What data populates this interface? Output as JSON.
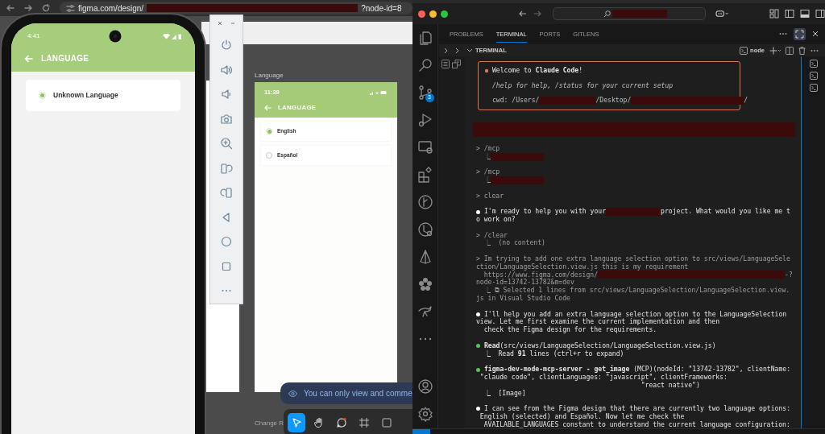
{
  "browser": {
    "url": [
      {
        "kind": "text",
        "text": "figma.com/design/"
      },
      {
        "kind": "redaction"
      },
      {
        "kind": "text",
        "text": "?node-id=8"
      }
    ]
  },
  "figma": {
    "frame_label": "Language",
    "frame": {
      "time": "11:39",
      "title": "LANGUAGE",
      "options": [
        {
          "label": "English",
          "selected": true
        },
        {
          "label": "Español",
          "selected": false
        }
      ]
    },
    "toast": "You can only view and comme",
    "canvas_label": "Change R",
    "tools": [
      {
        "kind": "move",
        "selected": true
      },
      {
        "kind": "hand",
        "selected": false
      },
      {
        "kind": "comment",
        "selected": false
      },
      {
        "kind": "frame",
        "selected": false
      },
      {
        "kind": "shape",
        "selected": false
      }
    ]
  },
  "phone": {
    "time": "4:41",
    "title": "LANGUAGE",
    "options": [
      {
        "label": "Unknown Language",
        "selected": true
      }
    ]
  },
  "vscode": {
    "scm_badge": "3",
    "tabs": [
      {
        "label": "PROBLEMS",
        "selected": false
      },
      {
        "label": "TERMINAL",
        "selected": true
      },
      {
        "label": "PORTS",
        "selected": false
      },
      {
        "label": "GITLENS",
        "selected": false
      }
    ],
    "terminal_title": "TERMINAL",
    "shell": "node",
    "welcome": {
      "title": "Welcome to **Claude Code**!",
      "hint": "/help for help, /status for your current setup",
      "cwd": [
        {
          "kind": "text",
          "text": "cwd: /Users/"
        },
        {
          "kind": "redaction"
        },
        {
          "kind": "text",
          "text": "/Desktop/"
        },
        {
          "kind": "redaction"
        },
        {
          "kind": "text",
          "text": "/"
        }
      ]
    },
    "entries": [
      {
        "kind": "redaction"
      },
      {
        "kind": "prompt",
        "lines": [
          [
            {
              "kind": "text",
              "text": "> /mcp"
            }
          ],
          [
            {
              "kind": "text",
              "text": "  ⎿"
            },
            {
              "kind": "redaction"
            }
          ]
        ]
      },
      {
        "kind": "prompt",
        "lines": [
          [
            {
              "kind": "text",
              "text": "> /mcp"
            }
          ],
          [
            {
              "kind": "text",
              "text": "  ⎿"
            },
            {
              "kind": "redaction"
            }
          ]
        ]
      },
      {
        "kind": "prompt",
        "lines": [
          [
            {
              "kind": "text",
              "text": "> clear"
            }
          ]
        ]
      },
      {
        "kind": "message",
        "color": "#ffffff",
        "lines": [
          [
            {
              "kind": "text",
              "text": "I'm ready to help you with your"
            },
            {
              "kind": "redaction"
            },
            {
              "kind": "text",
              "text": "project. What would you like me t"
            }
          ],
          [
            {
              "kind": "text",
              "text": "o work on?"
            }
          ]
        ]
      },
      {
        "kind": "prompt",
        "lines": [
          [
            {
              "kind": "text",
              "text": "> /clear"
            }
          ],
          [
            {
              "kind": "text",
              "text": "  ⎿  (no content)"
            }
          ]
        ]
      },
      {
        "kind": "prompt",
        "lines": [
          [
            {
              "kind": "text",
              "text": "> Im trying to add one extra language selection option to src/views/LanguageSele"
            }
          ],
          [
            {
              "kind": "text",
              "text": "ction/LanguageSelection.view.js this is my requirement"
            }
          ],
          [
            {
              "kind": "text",
              "text": "  https://www.figma.com/design/"
            },
            {
              "kind": "redaction"
            },
            {
              "kind": "text",
              "text": "-?"
            }
          ],
          [
            {
              "kind": "text",
              "text": "node-id=13742-13782&m=dev"
            }
          ],
          [
            {
              "kind": "text",
              "text": "  ⎿ ⧉ Selected 1 lines from src/views/LanguageSelection/LanguageSelection.view."
            }
          ],
          [
            {
              "kind": "text",
              "text": "js in Visual Studio Code"
            }
          ]
        ]
      },
      {
        "kind": "message",
        "color": "#ffffff",
        "lines": [
          [
            {
              "kind": "text",
              "text": "I'll help you add an extra language selection option to the LanguageSelection"
            }
          ],
          [
            {
              "kind": "text",
              "text": "view. Let me first examine the current implementation and then"
            }
          ],
          [
            {
              "kind": "text",
              "text": "  check the Figma design for the requirements."
            }
          ]
        ]
      },
      {
        "kind": "message",
        "color": "#4ec94e",
        "lines": [
          [
            {
              "kind": "text",
              "text": "**Read**(src/views/LanguageSelection/LanguageSelection.view.js)"
            }
          ],
          [
            {
              "kind": "text",
              "text": "  ⎿  Read **91** lines (ctrl+r to expand)"
            }
          ]
        ]
      },
      {
        "kind": "message",
        "color": "#4ec94e",
        "lines": [
          [
            {
              "kind": "text",
              "text": "**figma-dev-mode-mcp-server - get_image** (MCP)(nodeId: \"13742-13782\", clientName:"
            }
          ],
          [
            {
              "kind": "text",
              "text": " \"claude code\", clientLanguages: \"javascript\", clientFrameworks:"
            }
          ],
          [
            {
              "kind": "text",
              "text": "                                          \"react native\")"
            }
          ],
          [
            {
              "kind": "text",
              "text": "  ⎿  [Image]"
            }
          ]
        ]
      },
      {
        "kind": "message",
        "color": "#ffffff",
        "lines": [
          [
            {
              "kind": "text",
              "text": "I can see from the Figma design that there are currently two language options:"
            }
          ],
          [
            {
              "kind": "text",
              "text": " English (selected) and Español. Now let me check the"
            }
          ],
          [
            {
              "kind": "text",
              "text": "  AVAILABLE_LANGUAGES constant to understand the current language configuration:"
            }
          ]
        ]
      }
    ]
  }
}
